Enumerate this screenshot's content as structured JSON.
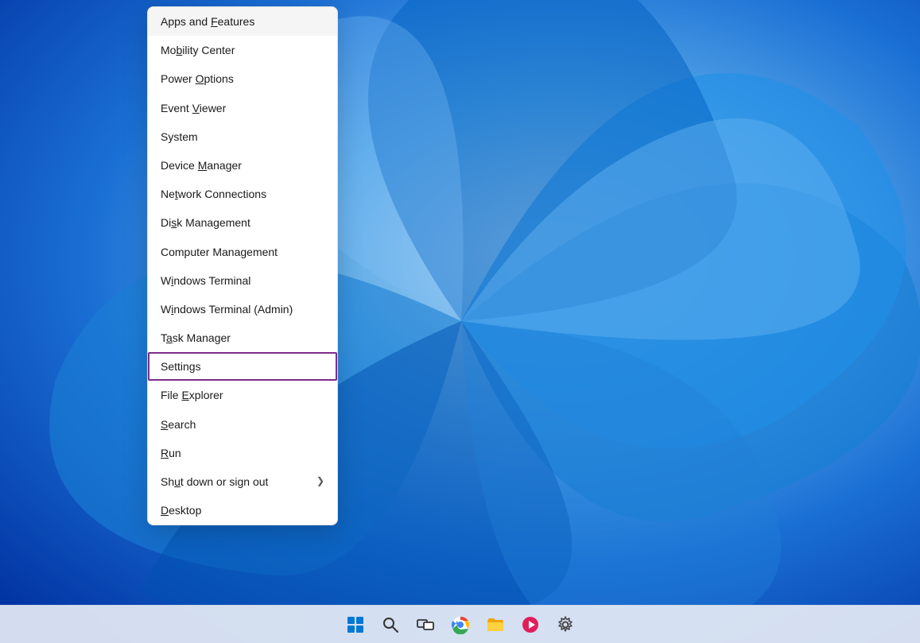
{
  "desktop": {
    "background_description": "Windows 11 blue swirl wallpaper"
  },
  "context_menu": {
    "items": [
      {
        "id": "apps-features",
        "label": "Apps and Features",
        "accel_index": 9,
        "has_arrow": false,
        "highlighted": true,
        "settings_border": false
      },
      {
        "id": "mobility-center",
        "label": "Mobility Center",
        "accel_index": 2,
        "has_arrow": false,
        "highlighted": false,
        "settings_border": false
      },
      {
        "id": "power-options",
        "label": "Power Options",
        "accel_index": 6,
        "has_arrow": false,
        "highlighted": false,
        "settings_border": false
      },
      {
        "id": "event-viewer",
        "label": "Event Viewer",
        "accel_index": 6,
        "has_arrow": false,
        "highlighted": false,
        "settings_border": false
      },
      {
        "id": "system",
        "label": "System",
        "accel_index": -1,
        "has_arrow": false,
        "highlighted": false,
        "settings_border": false
      },
      {
        "id": "device-manager",
        "label": "Device Manager",
        "accel_index": 7,
        "has_arrow": false,
        "highlighted": false,
        "settings_border": false
      },
      {
        "id": "network-connections",
        "label": "Network Connections",
        "accel_index": 2,
        "has_arrow": false,
        "highlighted": false,
        "settings_border": false
      },
      {
        "id": "disk-management",
        "label": "Disk Management",
        "accel_index": 2,
        "has_arrow": false,
        "highlighted": false,
        "settings_border": false
      },
      {
        "id": "computer-management",
        "label": "Computer Management",
        "accel_index": -1,
        "has_arrow": false,
        "highlighted": false,
        "settings_border": false
      },
      {
        "id": "windows-terminal",
        "label": "Windows Terminal",
        "accel_index": 1,
        "has_arrow": false,
        "highlighted": false,
        "settings_border": false
      },
      {
        "id": "windows-terminal-admin",
        "label": "Windows Terminal (Admin)",
        "accel_index": 1,
        "has_arrow": false,
        "highlighted": false,
        "settings_border": false
      },
      {
        "id": "task-manager",
        "label": "Task Manager",
        "accel_index": 1,
        "has_arrow": false,
        "highlighted": false,
        "settings_border": false
      },
      {
        "id": "settings",
        "label": "Settings",
        "accel_index": -1,
        "has_arrow": false,
        "highlighted": false,
        "settings_border": true
      },
      {
        "id": "file-explorer",
        "label": "File Explorer",
        "accel_index": 5,
        "has_arrow": false,
        "highlighted": false,
        "settings_border": false
      },
      {
        "id": "search",
        "label": "Search",
        "accel_index": 0,
        "has_arrow": false,
        "highlighted": false,
        "settings_border": false
      },
      {
        "id": "run",
        "label": "Run",
        "accel_index": 0,
        "has_arrow": false,
        "highlighted": false,
        "settings_border": false
      },
      {
        "id": "shut-down-sign-out",
        "label": "Shut down or sign out",
        "accel_index": 2,
        "has_arrow": true,
        "highlighted": false,
        "settings_border": false
      },
      {
        "id": "desktop",
        "label": "Desktop",
        "accel_index": 0,
        "has_arrow": false,
        "highlighted": false,
        "settings_border": false
      }
    ]
  },
  "taskbar": {
    "icons": [
      {
        "id": "start",
        "symbol": "⊞",
        "color": "#0078d4"
      },
      {
        "id": "search",
        "symbol": "⌕",
        "color": "#333"
      },
      {
        "id": "task-view",
        "symbol": "❐",
        "color": "#333"
      },
      {
        "id": "chrome",
        "symbol": "◉",
        "color": "#4285f4"
      },
      {
        "id": "file-explorer",
        "symbol": "📁",
        "color": "#f0a500"
      },
      {
        "id": "copilot",
        "symbol": "➤",
        "color": "#e01e5a"
      },
      {
        "id": "settings",
        "symbol": "⚙",
        "color": "#555"
      }
    ]
  }
}
